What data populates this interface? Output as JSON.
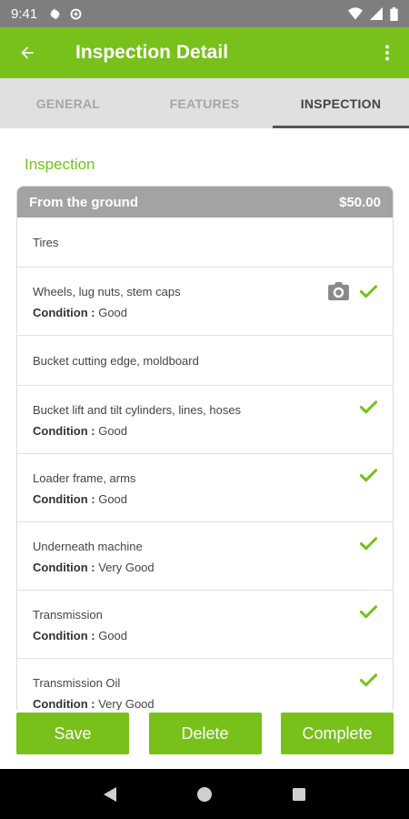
{
  "status_bar": {
    "time": "9:41"
  },
  "app_bar": {
    "title": "Inspection Detail"
  },
  "tabs": [
    {
      "label": "GENERAL",
      "active": false
    },
    {
      "label": "FEATURES",
      "active": false
    },
    {
      "label": "INSPECTION",
      "active": true
    }
  ],
  "section": {
    "title": "Inspection"
  },
  "card": {
    "title": "From the ground",
    "price": "$50.00",
    "condition_label": "Condition :",
    "items": [
      {
        "name": "Tires"
      },
      {
        "name": "Wheels, lug nuts, stem caps",
        "condition": "Good",
        "camera": true,
        "checked": true
      },
      {
        "name": "Bucket cutting edge, moldboard"
      },
      {
        "name": "Bucket lift and tilt cylinders, lines, hoses",
        "condition": "Good",
        "checked": true
      },
      {
        "name": "Loader frame, arms",
        "condition": "Good",
        "checked": true
      },
      {
        "name": "Underneath machine",
        "condition": "Very Good",
        "checked": true
      },
      {
        "name": "Transmission",
        "condition": "Good",
        "checked": true
      },
      {
        "name": "Transmission Oil",
        "condition": "Very Good",
        "checked": true
      }
    ]
  },
  "buttons": {
    "save": "Save",
    "delete": "Delete",
    "complete": "Complete"
  },
  "colors": {
    "accent": "#77c11a",
    "status_bar": "#7e7e7e",
    "card_header": "#a3a3a3"
  }
}
